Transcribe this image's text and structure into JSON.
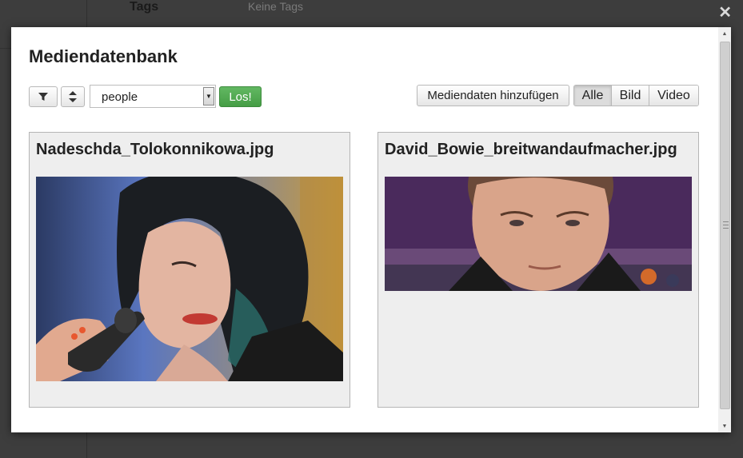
{
  "background": {
    "tags_label": "Tags",
    "tags_value": "Keine Tags"
  },
  "modal": {
    "title": "Mediendatenbank",
    "toolbar": {
      "filter_icon": "filter-icon",
      "sort_icon": "sort-icon",
      "search_value": "people",
      "go_label": "Los!",
      "add_label": "Mediendaten hinzufügen",
      "type_filters": [
        "Alle",
        "Bild",
        "Video"
      ],
      "active_filter": "Alle"
    },
    "items": [
      {
        "filename": "Nadeschda_Tolokonnikowa.jpg"
      },
      {
        "filename": "David_Bowie_breitwandaufmacher.jpg"
      }
    ]
  },
  "colors": {
    "go_button": "#459d45",
    "overlay": "#3a3a3a",
    "card_bg": "#eeeeee"
  }
}
